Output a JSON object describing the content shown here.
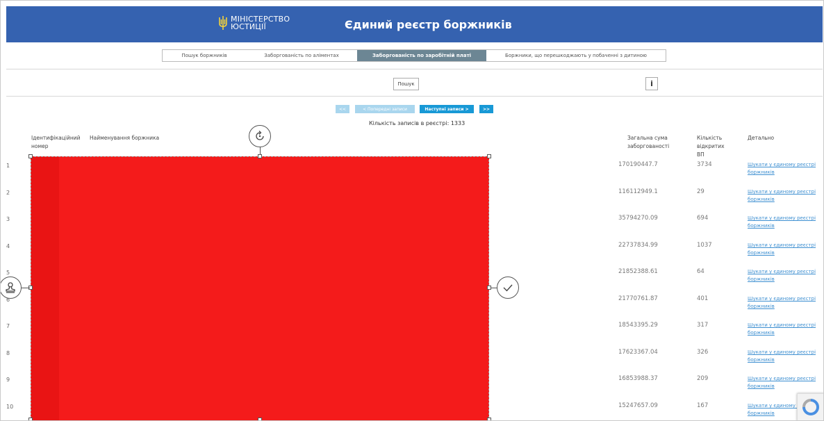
{
  "header": {
    "logo_line1": "МІНІСТЕРСТВО",
    "logo_line2": "ЮСТИЦІЇ",
    "title": "Єдиний реєстр боржників"
  },
  "tabs": [
    {
      "label": "Пошук боржників",
      "active": false
    },
    {
      "label": "Заборгованість по аліментах",
      "active": false
    },
    {
      "label": "Заборгованість по заробітній платі",
      "active": true
    },
    {
      "label": "Боржники, що перешкоджають у побаченні з дитиною",
      "active": false
    }
  ],
  "search_button": "Пошук",
  "info_button": "i",
  "pagination": {
    "first": "<<",
    "prev": "< Попередні записи",
    "next": "Наступні записи >",
    "last": ">>"
  },
  "record_count": "Кількість записів в реєстрі: 1333",
  "table": {
    "headers": {
      "id": "Ідентифікаційний номер",
      "name": "Найменування боржника",
      "sum": "Загальна сума заборгованості",
      "open": "Кількість відкритих ВП",
      "detail": "Детально"
    },
    "rows": [
      {
        "num": "1",
        "sum": "170190447.7",
        "count": "3734",
        "link": "Шукати у єдиному реєстрі боржників"
      },
      {
        "num": "2",
        "sum": "116112949.1",
        "count": "29",
        "link": "Шукати у єдиному реєстрі боржників"
      },
      {
        "num": "3",
        "sum": "35794270.09",
        "count": "694",
        "link": "Шукати у єдиному реєстрі боржників"
      },
      {
        "num": "4",
        "sum": "22737834.99",
        "count": "1037",
        "link": "Шукати у єдиному реєстрі боржників"
      },
      {
        "num": "5",
        "sum": "21852388.61",
        "count": "64",
        "link": "Шукати у єдиному реєстрі боржників"
      },
      {
        "num": "6",
        "sum": "21770761.87",
        "count": "401",
        "link": "Шукати у єдиному реєстрі боржників"
      },
      {
        "num": "7",
        "sum": "18543395.29",
        "count": "317",
        "link": "Шукати у єдиному реєстрі боржників"
      },
      {
        "num": "8",
        "sum": "17623367.04",
        "count": "326",
        "link": "Шукати у єдиному реєстрі боржників"
      },
      {
        "num": "9",
        "sum": "16853988.37",
        "count": "209",
        "link": "Шукати у єдиному реєстрі боржників"
      },
      {
        "num": "10",
        "sum": "15247657.09",
        "count": "167",
        "link": "Шукати у єдиному реєстрі боржників"
      }
    ]
  },
  "colors": {
    "header_bg": "#3562b0",
    "active_tab": "#6c8694",
    "redaction": "#f41b1b",
    "link": "#3d8fd1",
    "pager_active": "#1899d6",
    "pager_disabled": "#a9d6ee"
  },
  "icons": {
    "rotate": "rotate-icon",
    "stamp": "stamp-icon",
    "confirm": "check-icon",
    "logo": "trident-icon"
  }
}
